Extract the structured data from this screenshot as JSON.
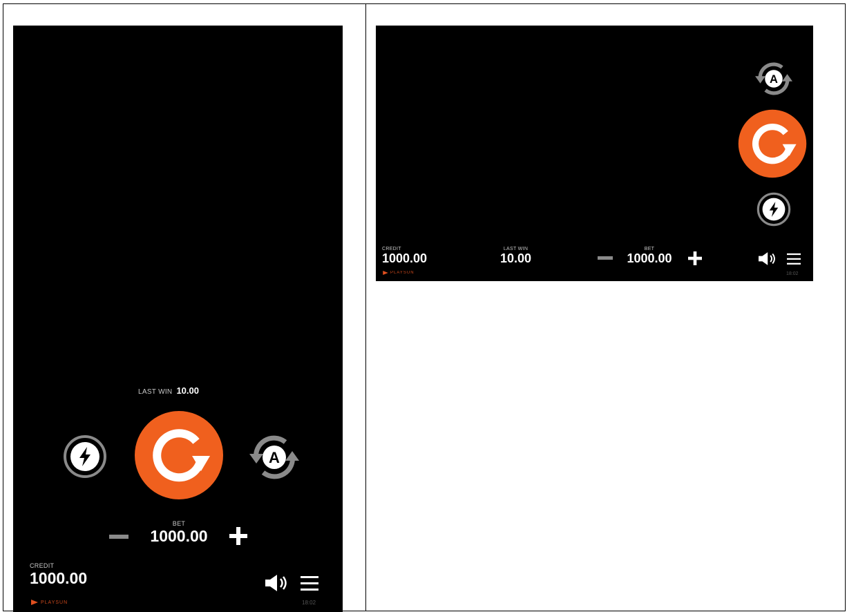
{
  "portrait": {
    "last_win_label": "LAST WIN",
    "last_win_value": "10.00",
    "bet_label": "BET",
    "bet_value": "1000.00",
    "credit_label": "CREDIT",
    "credit_value": "1000.00",
    "brand": "PLAYSUN",
    "time": "18:02"
  },
  "landscape": {
    "credit_label": "CREDIT",
    "credit_value": "1000.00",
    "last_win_label": "LAST WIN",
    "last_win_value": "10.00",
    "bet_label": "BET",
    "bet_value": "1000.00",
    "brand": "PLAYSUN",
    "time": "18:02"
  },
  "icons": {
    "spin": "spin-arrow-icon",
    "turbo": "lightning-icon",
    "autoplay": "autoplay-a-icon",
    "minus": "minus-icon",
    "plus": "plus-icon",
    "sound": "speaker-icon",
    "menu": "hamburger-menu-icon"
  },
  "colors": {
    "spin_button": "#f0601e",
    "background": "#000000",
    "icon_gray": "#8a8a8a"
  }
}
